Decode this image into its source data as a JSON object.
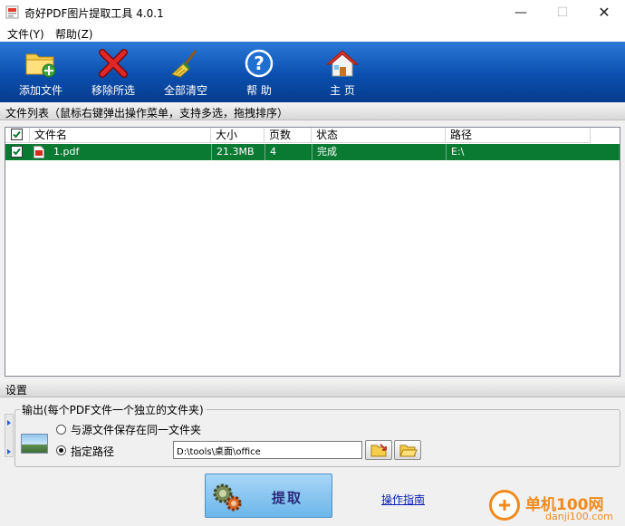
{
  "window": {
    "title": "奇好PDF图片提取工具 4.0.1",
    "min_glyph": "—",
    "max_glyph": "☐",
    "close_glyph": "✕"
  },
  "menu": {
    "file": "文件(Y)",
    "help": "帮助(Z)"
  },
  "toolbar": {
    "add": "添加文件",
    "remove": "移除所选",
    "clear": "全部清空",
    "help": "帮 助",
    "home": "主 页"
  },
  "file_list": {
    "section_title": "文件列表",
    "hint": "（鼠标右键弹出操作菜单，支持多选，拖拽排序）",
    "columns": [
      "文件名",
      "大小",
      "页数",
      "状态",
      "路径"
    ],
    "select_all_checked": true,
    "rows": [
      {
        "checked": true,
        "name": "1.pdf",
        "size": "21.3MB",
        "pages": "4",
        "status": "完成",
        "path": "E:\\"
      }
    ]
  },
  "settings": {
    "section_title": "设置",
    "group_title": "输出(每个PDF文件一个独立的文件夹)",
    "option_same_folder": "与源文件保存在同一文件夹",
    "option_custom_path": "指定路径",
    "selected_option": "custom",
    "path_value": "D:\\tools\\桌面\\office"
  },
  "actions": {
    "extract": "提取",
    "guide": "操作指南"
  },
  "watermark": {
    "name": "单机100网",
    "url": "danji100.com"
  },
  "colors": {
    "toolbar": "#0b4fae",
    "selected_row": "#0a7a32",
    "link": "#0a1fb5",
    "watermark": "#f08a1e"
  }
}
